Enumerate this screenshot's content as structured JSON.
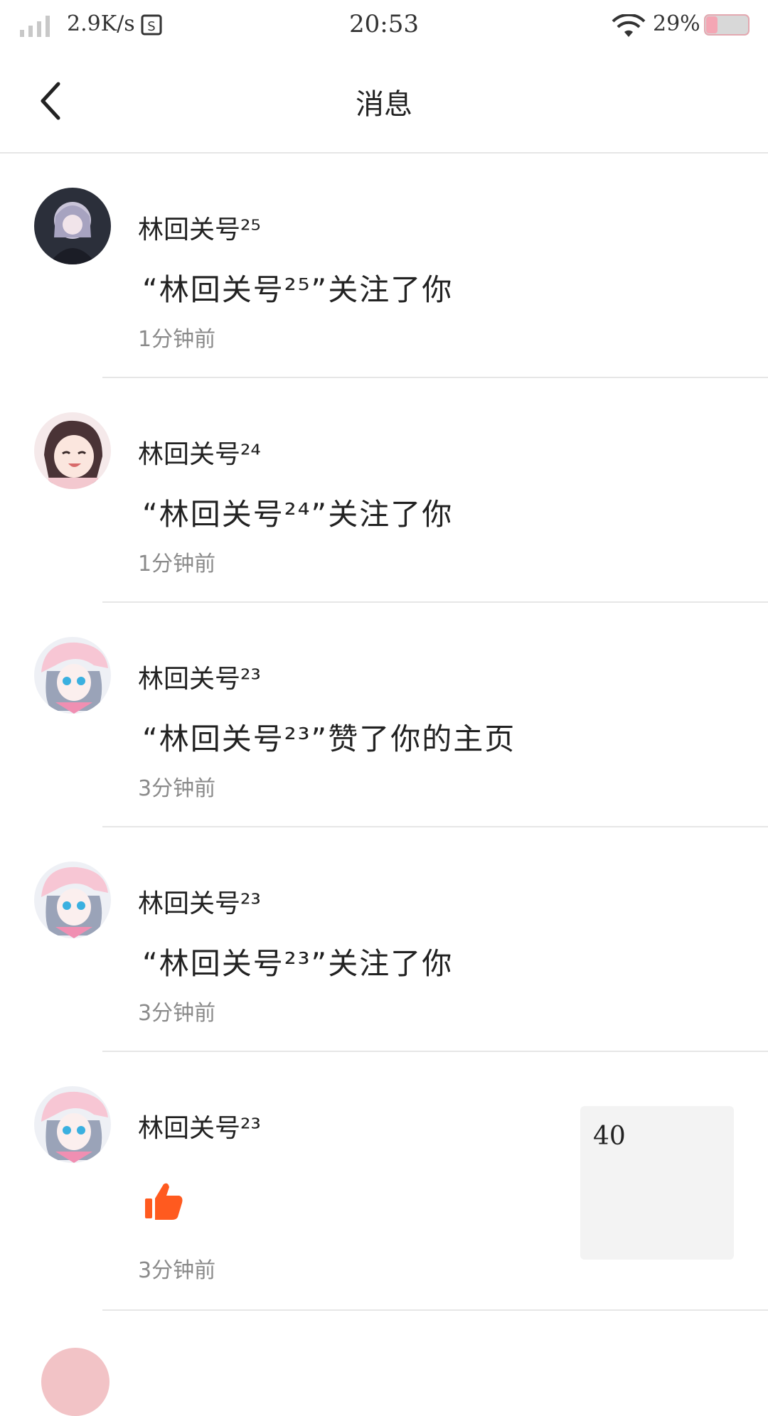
{
  "status_bar": {
    "network_speed": "2.9K/s",
    "time": "20:53",
    "battery_percent": "29%",
    "icons": [
      "signal-icon",
      "s-app-icon",
      "wifi-icon",
      "battery-icon"
    ]
  },
  "header": {
    "title": "消息",
    "back_icon": "back-chevron-icon"
  },
  "messages": [
    {
      "user": "林回关号²⁵",
      "text": "“林回关号²⁵”关注了你",
      "time": "1分钟前",
      "avatar_icon": "avatar-dark-hair-icon"
    },
    {
      "user": "林回关号²⁴",
      "text": "“林回关号²⁴”关注了你",
      "time": "1分钟前",
      "avatar_icon": "avatar-smiling-girl-icon"
    },
    {
      "user": "林回关号²³",
      "text": "“林回关号²³”赞了你的主页",
      "time": "3分钟前",
      "avatar_icon": "avatar-pink-cap-girl-icon"
    },
    {
      "user": "林回关号²³",
      "text": "“林回关号²³”关注了你",
      "time": "3分钟前",
      "avatar_icon": "avatar-pink-cap-girl-icon"
    },
    {
      "user": "林回关号²³",
      "like_icon": "thumbs-up-icon",
      "time": "3分钟前",
      "thumbnail_text": "40",
      "avatar_icon": "avatar-pink-cap-girl-icon"
    }
  ],
  "colors": {
    "like": "#ff5a1f",
    "divider": "#e6e6e6",
    "time_text": "#8a8a8a",
    "thumbnail_bg": "#f3f3f3"
  }
}
